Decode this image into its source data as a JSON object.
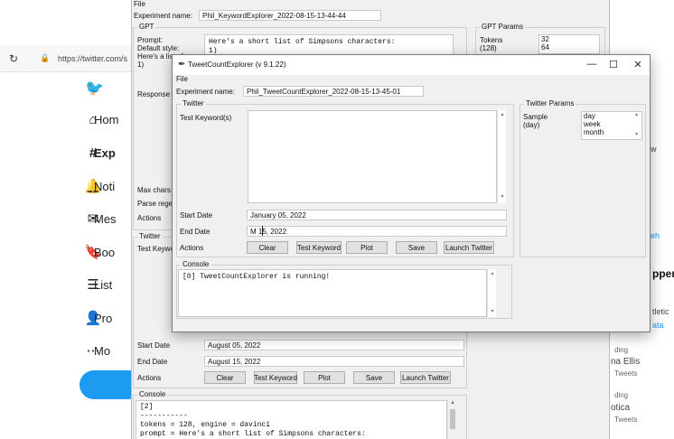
{
  "browser": {
    "url": "https://twitter.com/s"
  },
  "twitter_nav": {
    "items": [
      {
        "label": "Hom",
        "icon": "home-icon"
      },
      {
        "label": "Exp",
        "icon": "hashtag-icon"
      },
      {
        "label": "Noti",
        "icon": "bell-icon"
      },
      {
        "label": "Mes",
        "icon": "mail-icon"
      },
      {
        "label": "Boo",
        "icon": "bookmark-icon"
      },
      {
        "label": "List",
        "icon": "list-icon"
      },
      {
        "label": "Pro",
        "icon": "person-icon"
      },
      {
        "label": "Mo",
        "icon": "more-icon"
      }
    ]
  },
  "right_sidebar": {
    "lines": [
      {
        "text": "ers",
        "style": "bold"
      },
      {
        "text": "w",
        "style": "normal"
      },
      {
        "text": "eh",
        "style": "blue"
      },
      {
        "text": "ppen",
        "style": "bold"
      },
      {
        "text": "tletic",
        "style": "normal"
      },
      {
        "text": "ata",
        "style": "blue"
      },
      {
        "text": "ding",
        "style": "small"
      },
      {
        "text": "na Ellis",
        "style": "normal"
      },
      {
        "text": "Tweets",
        "style": "small"
      },
      {
        "text": "ding",
        "style": "small"
      },
      {
        "text": "otica",
        "style": "normal"
      },
      {
        "text": "Tweets",
        "style": "small"
      }
    ]
  },
  "back_window": {
    "menu_file": "File",
    "experiment_label": "Experiment name:",
    "experiment_value": "Phil_KeywordExplorer_2022-08-15-13-44-44",
    "gpt_group": "GPT",
    "prompt_label": "Prompt:",
    "default_style_label": "Default style:",
    "heres_list_label": "Here's a list of",
    "one_label": "1)",
    "prompt_text": "Here's a short list of Simpsons characters:\n1)",
    "response_label": "Response",
    "max_chars_label": "Max chars:",
    "parse_regex_label": "Parse regex",
    "actions_label": "Actions",
    "gpt_params_group": "GPT Params",
    "tokens_label": "Tokens",
    "tokens_sub": "(128)",
    "tokens_options": [
      "32",
      "64"
    ],
    "twitter_group": "Twitter",
    "test_keyword_label": "Test Keyword",
    "start_date_label": "Start Date",
    "start_date_value": "August 05, 2022",
    "end_date_label": "End Date",
    "end_date_value": "August 15, 2022",
    "actions2_label": "Actions",
    "buttons": {
      "clear": "Clear",
      "test_keyword": "Test Keyword",
      "plot": "Plot",
      "save": "Save",
      "launch_twitter": "Launch Twitter"
    },
    "console_group": "Console",
    "console_text": "[2]\n-----------\ntokens = 128, engine = davinci\nprompt = Here's a short list of Simpsons characters:"
  },
  "front_window": {
    "title": "TweetCountExplorer (v 9.1.22)",
    "menu_file": "File",
    "experiment_label": "Experiment name:",
    "experiment_value": "Phil_TweetCountExplorer_2022-08-15-13-45-01",
    "twitter_group": "Twitter",
    "test_keywords_label": "Test Keyword(s)",
    "start_date_label": "Start Date",
    "start_date_value": "January 05, 2022",
    "end_date_label": "End Date",
    "end_date_value": "M 15, 2022",
    "actions_label": "Actions",
    "buttons": {
      "clear": "Clear",
      "test_keyword": "Test Keyword",
      "plot": "Plot",
      "save": "Save",
      "launch_twitter": "Launch Twitter"
    },
    "twitter_params_group": "Twitter Params",
    "sample_label": "Sample",
    "sample_sub": "(day)",
    "sample_options": [
      "day",
      "week",
      "month"
    ],
    "console_group": "Console",
    "console_text": "[0] TweetCountExplorer is running!"
  },
  "colors": {
    "twitter_blue": "#1d9bf0",
    "selection_blue": "#0078d7"
  }
}
